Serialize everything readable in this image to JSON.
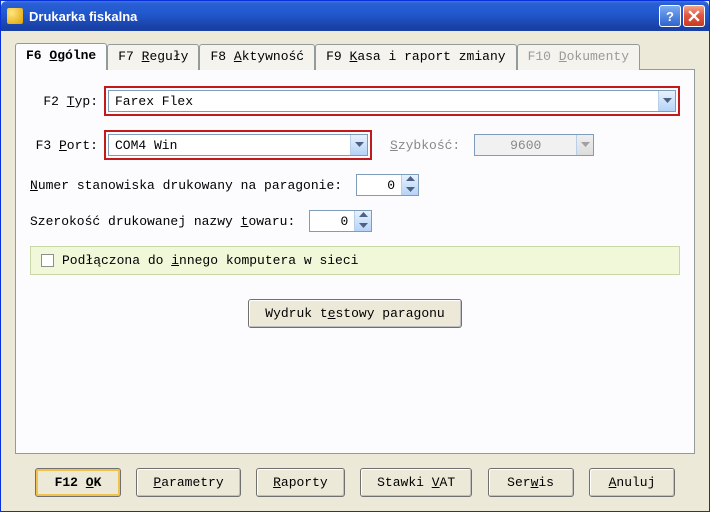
{
  "window": {
    "title": "Drukarka fiskalna"
  },
  "tabs": [
    {
      "prefix": "F6",
      "u": "O",
      "rest": "gólne",
      "active": true,
      "disabled": false
    },
    {
      "prefix": "F7",
      "u": "R",
      "rest": "eguły",
      "active": false,
      "disabled": false
    },
    {
      "prefix": "F8",
      "u": "A",
      "rest": "ktywność",
      "active": false,
      "disabled": false
    },
    {
      "prefix": "F9",
      "u": "K",
      "rest": "asa i raport zmiany",
      "active": false,
      "disabled": false
    },
    {
      "prefix": "F10",
      "u": "D",
      "rest": "okumenty",
      "active": false,
      "disabled": true
    }
  ],
  "form": {
    "typ": {
      "prefix": "F2 ",
      "u": "T",
      "rest": "yp:",
      "value": "Farex Flex"
    },
    "port": {
      "prefix": "F3 ",
      "u": "P",
      "rest": "ort:",
      "value": "COM4 Win"
    },
    "speed": {
      "pre": "",
      "u": "S",
      "rest": "zybkość:",
      "value": "9600"
    },
    "numer": {
      "pre": "",
      "u": "N",
      "rest": "umer stanowiska drukowany na paragonie:",
      "value": "0"
    },
    "szer": {
      "pre": "Szerokość drukowanej nazwy ",
      "u": "t",
      "rest": "owaru:",
      "value": "0"
    },
    "check": {
      "pre": "Podłączona do ",
      "u": "i",
      "rest": "nnego komputera w sieci",
      "checked": false
    },
    "testbtn": {
      "pre": "Wydruk t",
      "u": "e",
      "rest": "stowy paragonu"
    }
  },
  "buttons": {
    "ok": {
      "pre": "F12 ",
      "u": "O",
      "rest": "K"
    },
    "param": {
      "pre": "",
      "u": "P",
      "rest": "arametry"
    },
    "raport": {
      "pre": "",
      "u": "R",
      "rest": "aporty"
    },
    "vat": {
      "pre": "Stawki ",
      "u": "V",
      "rest": "AT"
    },
    "serwis": {
      "pre": "Ser",
      "u": "w",
      "rest": "is"
    },
    "anuluj": {
      "pre": "",
      "u": "A",
      "rest": "nuluj"
    }
  }
}
